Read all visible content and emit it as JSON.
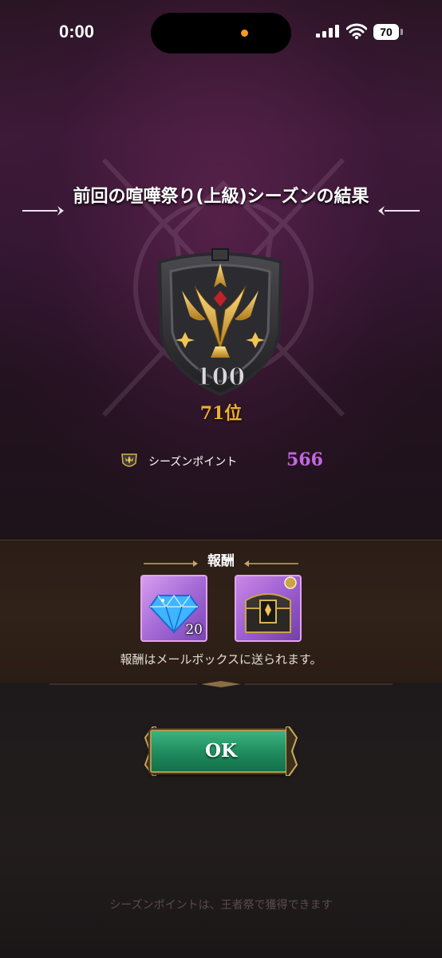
{
  "status_bar": {
    "time": "0:00",
    "battery": "70",
    "icons": [
      "signal-icon",
      "wifi-icon",
      "battery-icon"
    ]
  },
  "result": {
    "title": "前回の喧嘩祭り(上級)シーズンの結果",
    "badge_number": "100",
    "rank": "71位",
    "season_points_label": "シーズンポイント",
    "season_points_value": "566"
  },
  "reward": {
    "title": "報酬",
    "items": [
      {
        "icon": "diamond-gem-icon",
        "quantity": "20"
      },
      {
        "icon": "treasure-chest-icon",
        "quantity": ""
      }
    ],
    "note": "報酬はメールボックスに送られます。"
  },
  "ok_button": {
    "label": "OK"
  },
  "footer_note": "シーズンポイントは、王者祭で獲得できます",
  "colors": {
    "rank_gold": "#f0b02a",
    "points_purple": "#c467e0",
    "ok_green": "#1f8a5c"
  }
}
